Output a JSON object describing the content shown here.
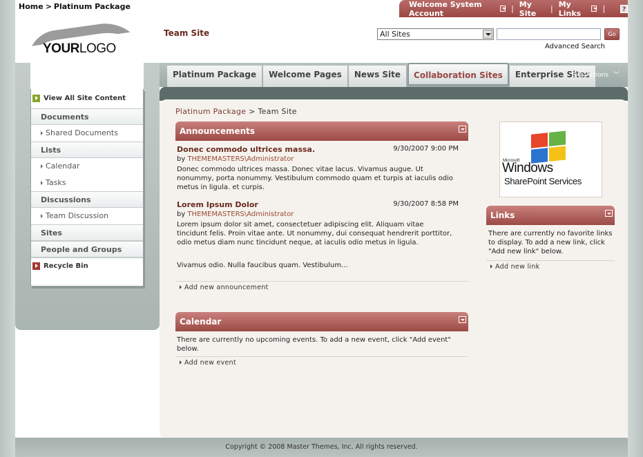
{
  "top_breadcrumb": {
    "home": "Home",
    "separator": ">",
    "current": "Platinum Package"
  },
  "welcome_bar": {
    "welcome": "Welcome System Account",
    "my_site": "My Site",
    "my_links": "My Links",
    "pipe": "|",
    "help": "?"
  },
  "logo": {
    "bold": "YOUR",
    "light": "LOGO"
  },
  "site_title": "Team Site",
  "search": {
    "scope": "All Sites",
    "value": "",
    "go": "Go",
    "advanced": "Advanced Search"
  },
  "left_nav": {
    "view_all": "View All Site Content",
    "sections": [
      {
        "label": "Documents",
        "children": [
          "Shared Documents"
        ]
      },
      {
        "label": "Lists",
        "children": [
          "Calendar",
          "Tasks"
        ]
      },
      {
        "label": "Discussions",
        "children": [
          "Team Discussion"
        ]
      },
      {
        "label": "Sites",
        "children": []
      },
      {
        "label": "People and Groups",
        "children": []
      }
    ],
    "recycle_bin": "Recycle Bin"
  },
  "tabs": [
    {
      "label": "Platinum Package",
      "active": false
    },
    {
      "label": "Welcome Pages",
      "active": false
    },
    {
      "label": "News Site",
      "active": false
    },
    {
      "label": "Collaboration Sites",
      "active": true
    },
    {
      "label": "Enterprise Sites",
      "active": false
    }
  ],
  "site_actions": "Site Actions",
  "content_breadcrumb": {
    "first": "Platinum Package",
    "sep": ">",
    "current": "Team Site"
  },
  "announcements": {
    "title": "Announcements",
    "items": [
      {
        "title": "Donec commodo ultrices massa.",
        "date": "9/30/2007 9:00 PM",
        "by": "by",
        "author": "THEMEMASTERS\\Administrator",
        "body": "Donec commodo ultrices massa. Donec vitae lacus. Vivamus augue. Ut nonummy, porta nonummy. Vestibulum commodo quam et turpis at iaculis odio metus in ligula. et curpis."
      },
      {
        "title": "Lorem Ipsum Dolor",
        "date": "9/30/2007 8:58 PM",
        "by": "by",
        "author": "THEMEMASTERS\\Administrator",
        "body": "Lorem ipsum dolor sit amet, consectetuer adipiscing elit. Aliquam vitae tincidunt felis. Proin vitae ante. Ut nonummy, dui consequat hendrerit porttitor, odio metus diam nunc tincidunt neque, at iaculis odio metus in ligula.",
        "body2": "Vivamus odio. Nulla faucibus quam. Vestibulum..."
      }
    ],
    "add_link": "Add new announcement"
  },
  "calendar": {
    "title": "Calendar",
    "empty_text": "There are currently no upcoming events. To add a new event, click \"Add event\" below.",
    "add_link": "Add new event"
  },
  "sharepoint_logo": {
    "microsoft": "Microsoft",
    "windows": "Windows",
    "services": "SharePoint Services"
  },
  "links": {
    "title": "Links",
    "empty_text": "There are currently no favorite links to display. To add a new link, click \"Add new link\" below.",
    "add_link": "Add new link"
  },
  "footer": {
    "copyright": "Copyright © 2008 Master Themes, Inc. All rights reserved."
  },
  "colors": {
    "accent": "#9c4a46",
    "frame": "#b7c2bf",
    "dark_band": "#5c6c69",
    "content_bg": "#f5f2ee"
  }
}
